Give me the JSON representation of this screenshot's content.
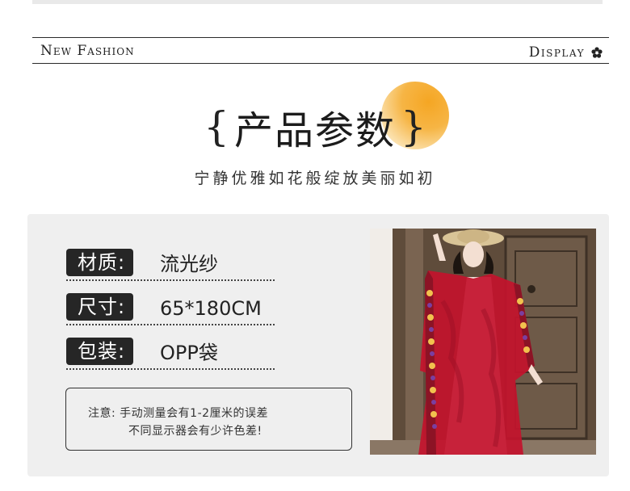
{
  "banner": {
    "left_text": "New Fashion",
    "right_text": "Display",
    "right_icon": "flower-icon"
  },
  "heading": {
    "brace_open": "{",
    "title": "产品参数",
    "brace_close": "}",
    "subtitle": "宁静优雅如花般绽放美丽如初"
  },
  "params": [
    {
      "label": "材质:",
      "value": "流光纱"
    },
    {
      "label": "尺寸:",
      "value": "65*180CM"
    },
    {
      "label": "包装:",
      "value": "OPP袋"
    }
  ],
  "note": {
    "line1": "注意:  手动测量会有1-2厘米的误差",
    "line2": "不同显示器会有少许色差!"
  },
  "photo": {
    "subject": "woman-in-red-embroidered-shawl",
    "colors": {
      "shawl": "#c3122d",
      "door": "#6e5a48",
      "wall": "#e8e2da"
    }
  },
  "colors": {
    "accent": "#f5a623",
    "panel": "#efefef",
    "label_bg": "#262626"
  }
}
